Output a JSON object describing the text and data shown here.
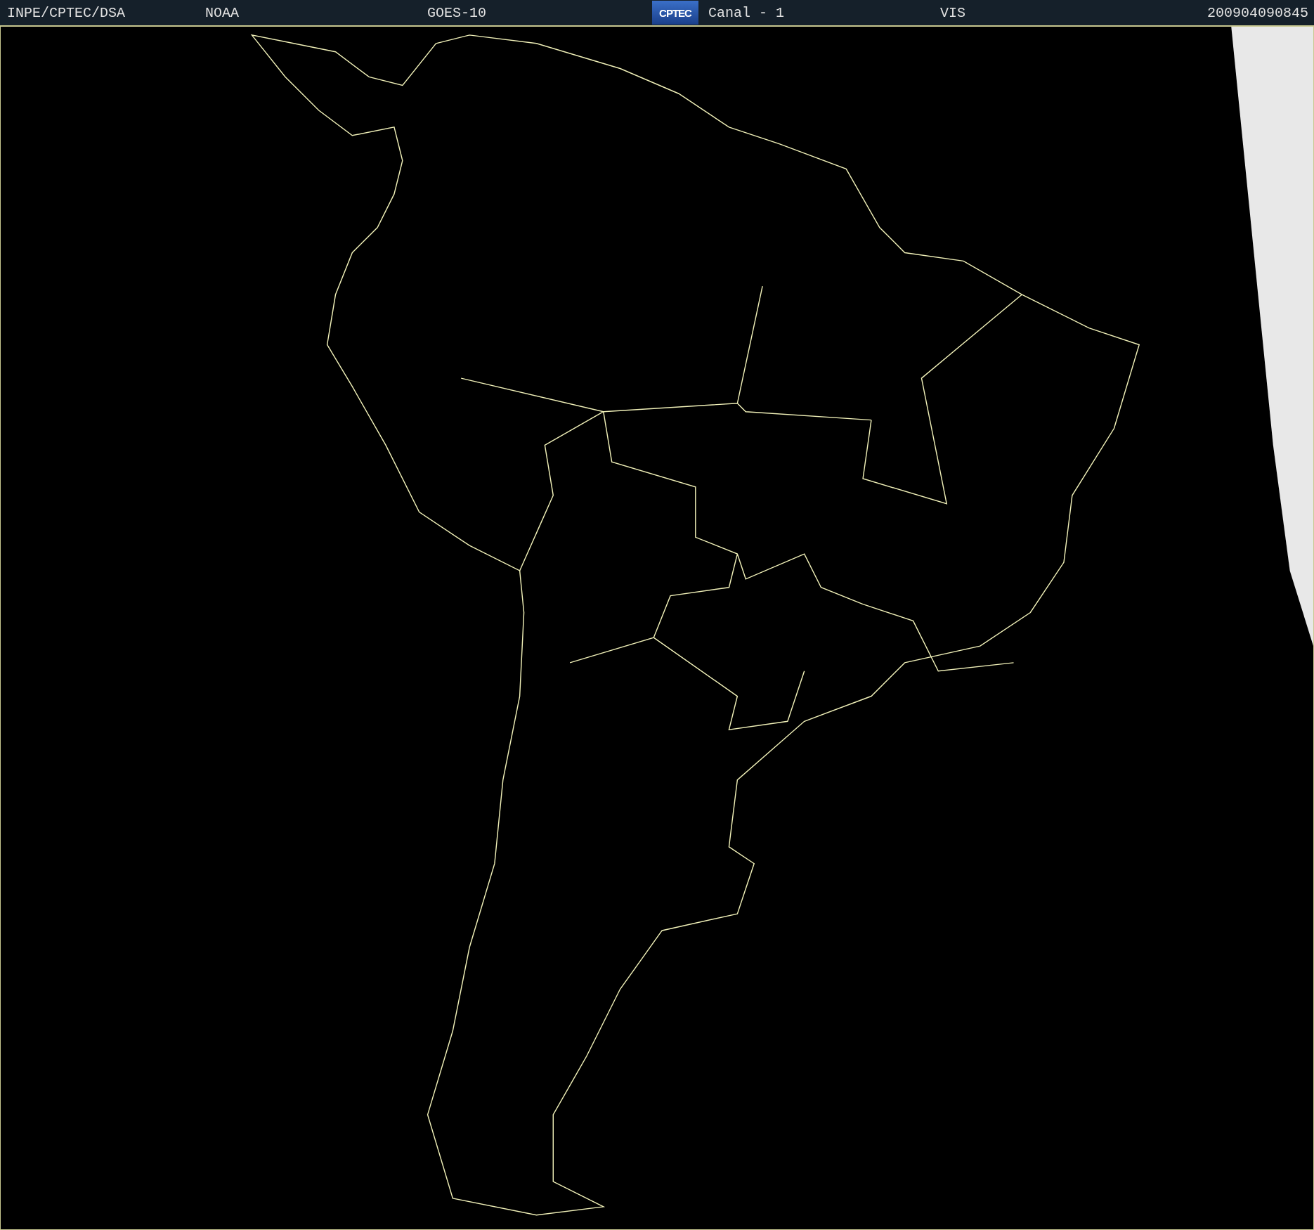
{
  "header": {
    "agency": "INPE/CPTEC/DSA",
    "source": "NOAA",
    "satellite": "GOES-10",
    "logo_text": "CPTEC",
    "channel": "Canal - 1",
    "band": "VIS",
    "timestamp": "200904090845"
  }
}
